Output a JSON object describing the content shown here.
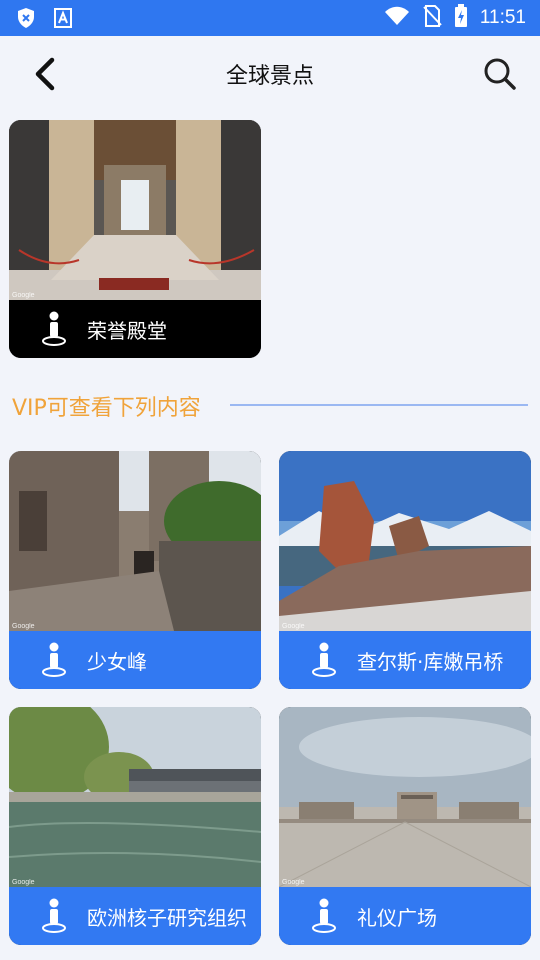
{
  "status_bar": {
    "time": "11:51"
  },
  "header": {
    "title": "全球景点"
  },
  "featured": {
    "name": "荣誉殿堂"
  },
  "vip_section": {
    "heading": "VIP可查看下列内容"
  },
  "places": [
    {
      "name": "少女峰"
    },
    {
      "name": "查尔斯·库嫩吊桥"
    },
    {
      "name": "欧洲核子研究组织"
    },
    {
      "name": "礼仪广场"
    }
  ],
  "watermark": "Google",
  "colors": {
    "status_bar": "#2f77f0",
    "card_band": "#3279f2",
    "vip_heading": "#f0a33a",
    "background": "#f2f4fa"
  },
  "icons": [
    "shield-x-icon",
    "font-a-icon",
    "wifi-icon",
    "no-sim-icon",
    "battery-charging-icon",
    "back-arrow-icon",
    "search-icon",
    "street-view-person-icon"
  ]
}
